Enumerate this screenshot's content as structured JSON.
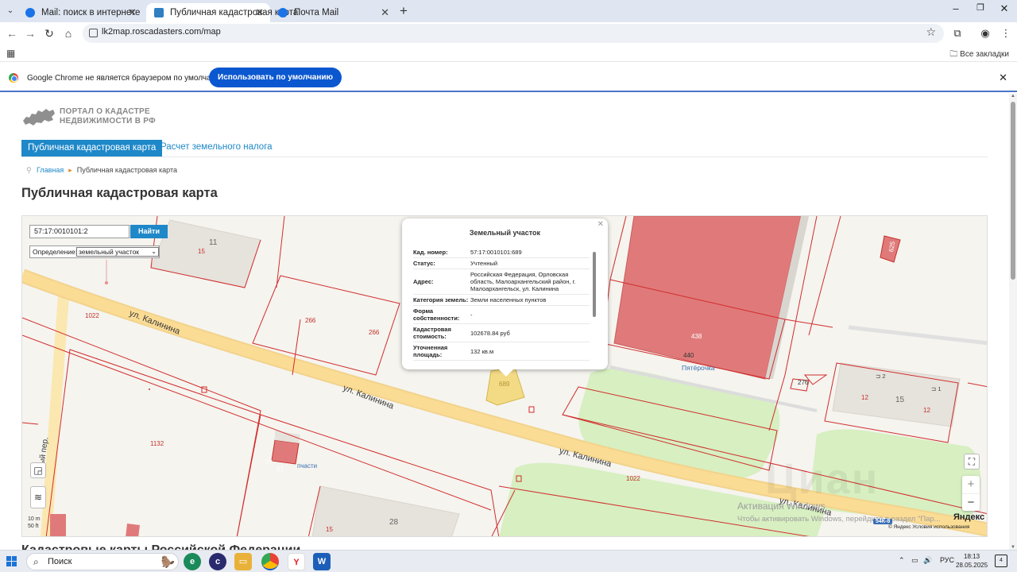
{
  "browser": {
    "tabs": [
      {
        "title": "Mail: поиск в интернете",
        "active": false,
        "favicon_color": "#1a73e8"
      },
      {
        "title": "Публичная кадастровая карта",
        "active": true,
        "favicon_color": "#2f7fc1"
      },
      {
        "title": "Почта Mail",
        "active": false,
        "favicon_color": "#1a73e8"
      }
    ],
    "url": "lk2map.roscadasters.com/map",
    "bookmarks_all": "Все закладки",
    "infobar": {
      "text": "Google Chrome не является браузером по умолчанию.",
      "button": "Использовать по умолчанию"
    }
  },
  "site": {
    "logo_line1": "ПОРТАЛ О КАДАСТРЕ",
    "logo_line2": "НЕДВИЖИМОСТИ В РФ",
    "nav": [
      {
        "label": "Публичная кадастровая карта",
        "active": true
      },
      {
        "label": "Расчет земельного налога",
        "active": false
      }
    ],
    "breadcrumb": {
      "home": "Главная",
      "current": "Публичная кадастровая карта"
    },
    "page_title": "Публичная кадастровая карта",
    "bottom_heading": "Кадастровые карты Российской Федерации"
  },
  "map": {
    "search_value": "57:17:0010101:2",
    "search_button": "Найти",
    "definition_label": "Определение:",
    "definition_value": "земельный участок",
    "popup": {
      "title": "Земельный участок",
      "rows": [
        {
          "key": "Кад. номер:",
          "value": "57:17:0010101:689"
        },
        {
          "key": "Статус:",
          "value": "Учтенный"
        },
        {
          "key": "Адрес:",
          "value": "Российская Федерация, Орловская область, Малоархангельский район, г. Малоархангельск, ул. Калинина"
        },
        {
          "key": "Категория земель:",
          "value": "Земли населенных пунктов"
        },
        {
          "key": "Форма собственности:",
          "value": "-"
        },
        {
          "key": "Кадастровая стоимость:",
          "value": "102678.84 руб"
        },
        {
          "key": "Уточненная площадь:",
          "value": "132 кв.м"
        }
      ]
    },
    "streets": {
      "kalinina": "ул. Калинина",
      "pereulok": "ый пер."
    },
    "parcel_labels": {
      "p1022": "1022",
      "p266a": "266",
      "p266b": "266",
      "p1132": "1132",
      "p689": "689",
      "p440": "440",
      "p438": "438",
      "p276": "276",
      "p1022b": "1022",
      "p15a": "15",
      "p15b": "15",
      "p67": "67",
      "p77": "77",
      "p12a": "12",
      "p12b": "12",
      "p625": "625"
    },
    "building_numbers": {
      "b11": "11",
      "b15": "15",
      "b28": "28",
      "b2": "2",
      "b1": "1"
    },
    "poi": {
      "pyaterochka": "Пятёрочка",
      "zapchasti": "пчасти"
    },
    "scale": {
      "metric": "10 m",
      "imperial": "50 ft"
    },
    "road_badge": "54К-8",
    "yandex": "Яндекс",
    "yandex_terms": "© Яндекс  Условия использования",
    "activation_title": "Активация Windows",
    "activation_sub": "Чтобы активировать Windows, перейдите в раздел \"Пар...",
    "watermark": "Циан"
  },
  "taskbar": {
    "search": "Поиск",
    "lang": "РУС",
    "time": "18:13",
    "date": "28.05.2025",
    "notif_count": "4"
  },
  "colors": {
    "accent": "#1e88c9",
    "parcel_line": "#d22c2c",
    "parcel_selected": "#f3db86",
    "building_red": "#e06a6a",
    "green_zone": "#d7efc1",
    "road": "#fbd98d"
  }
}
